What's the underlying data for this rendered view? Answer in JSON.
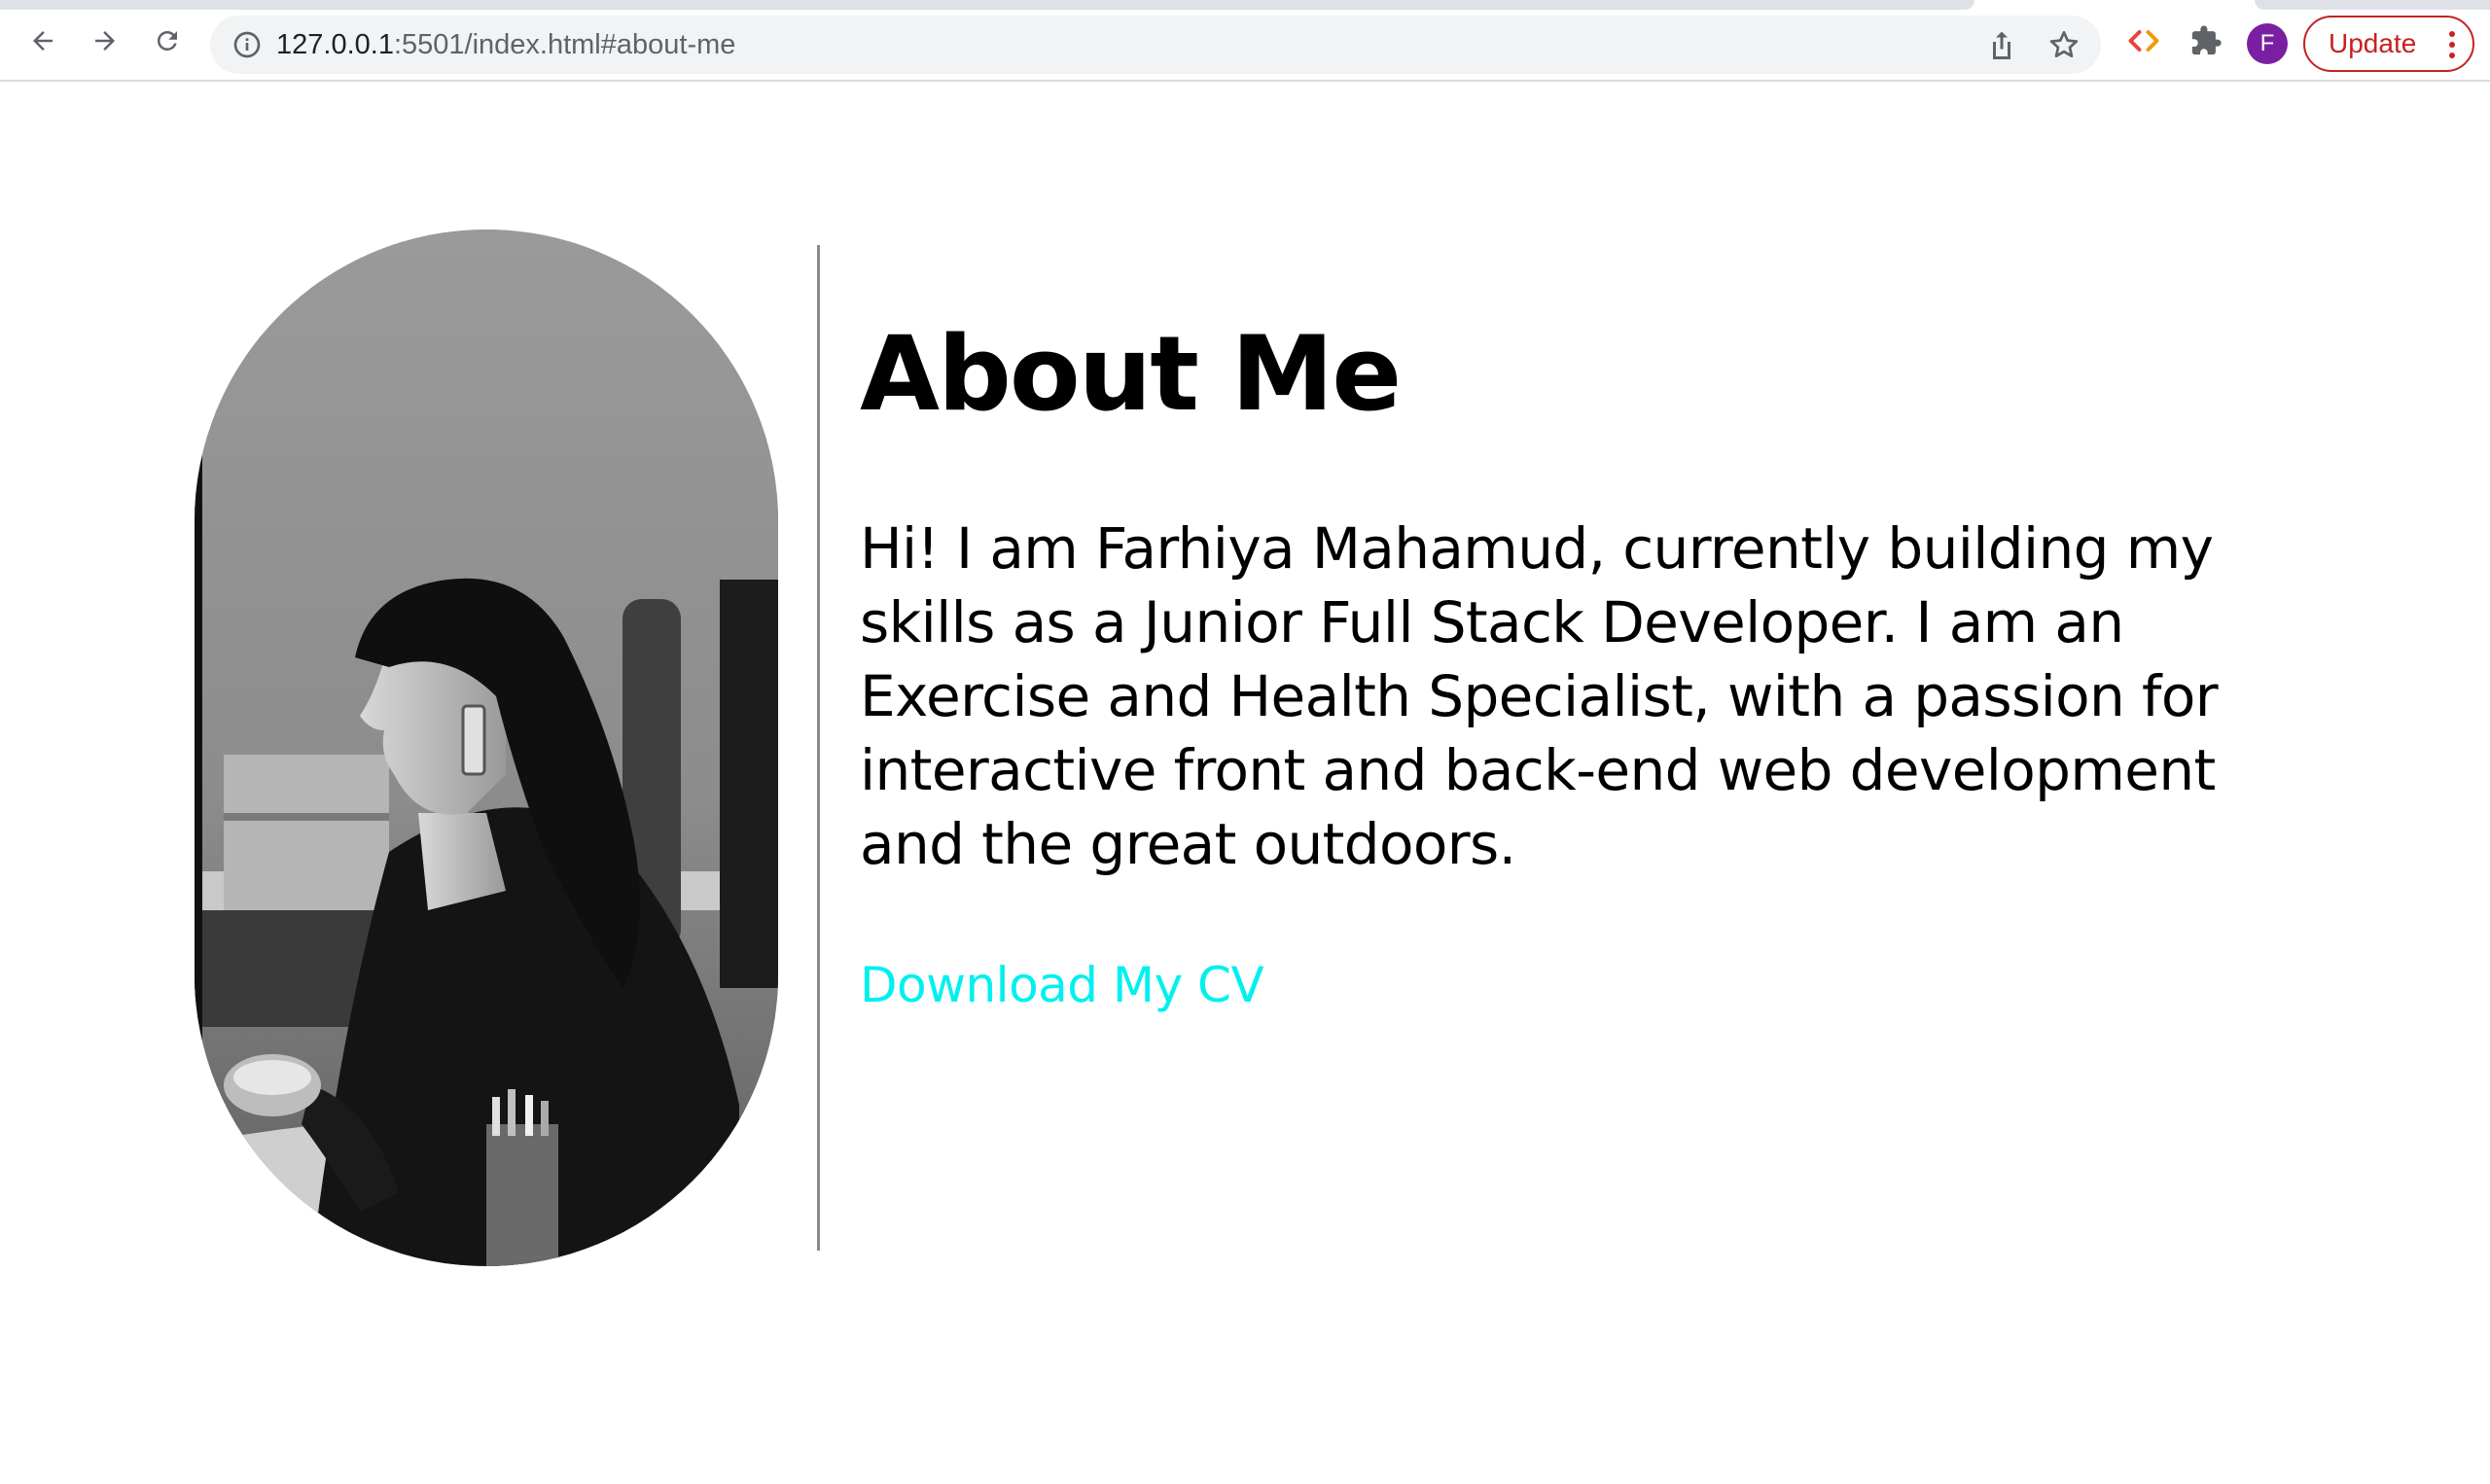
{
  "browser": {
    "url_host": "127.0.0.1",
    "url_rest": ":5501/index.html#about-me",
    "profile_initial": "F",
    "update_label": "Update",
    "icons": [
      "back-icon",
      "forward-icon",
      "reload-icon",
      "site-info-icon",
      "share-icon",
      "bookmark-star-icon",
      "devtools-extension-icon",
      "extensions-puzzle-icon",
      "menu-dots-icon"
    ],
    "colors": {
      "avatar": "#7b1fa2",
      "update": "#c5221f"
    }
  },
  "about": {
    "heading": "About Me",
    "bio": "Hi! I am Farhiya Mahamud, currently building my skills as a Junior Full Stack Developer. I am an Exercise and Health Specialist, with a passion for interactive front and back-end web development and the great outdoors.",
    "cv_link": "Download My CV",
    "colors": {
      "link": "#00f0f0",
      "text": "#000000"
    }
  }
}
